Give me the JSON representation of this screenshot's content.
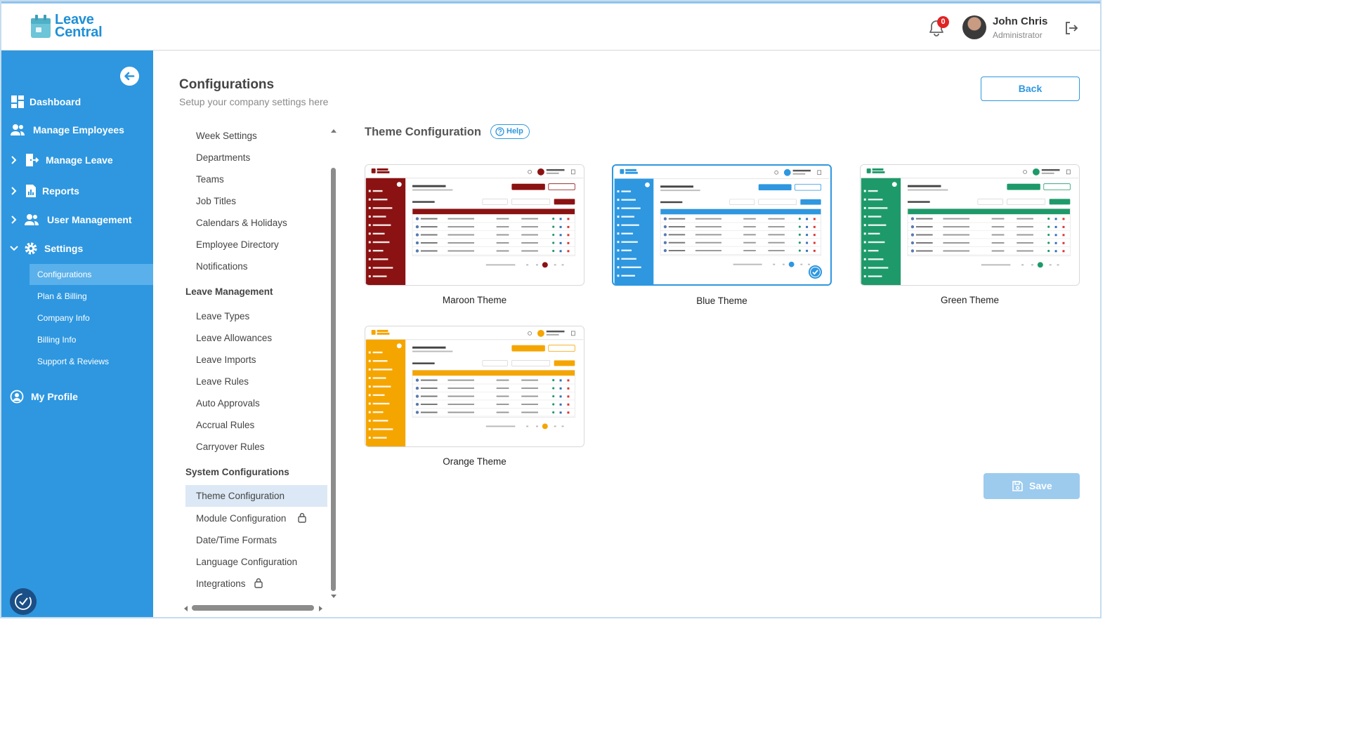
{
  "app": {
    "logo_line1": "Leave",
    "logo_line2": "Central"
  },
  "header": {
    "notification_count": "0",
    "user_name": "John Chris",
    "user_role": "Administrator"
  },
  "sidebar": {
    "items": [
      {
        "label": "Dashboard",
        "icon": "dashboard-icon"
      },
      {
        "label": "Manage Employees",
        "icon": "users-icon"
      },
      {
        "label": "Manage Leave",
        "icon": "door-exit-icon"
      },
      {
        "label": "Reports",
        "icon": "report-icon"
      },
      {
        "label": "User Management",
        "icon": "users-icon"
      },
      {
        "label": "Settings",
        "icon": "gear-icon"
      }
    ],
    "settings_children": [
      "Configurations",
      "Plan & Billing",
      "Company Info",
      "Billing Info",
      "Support & Reviews"
    ],
    "profile": "My Profile"
  },
  "page": {
    "title": "Configurations",
    "subtitle": "Setup your company settings here",
    "back_label": "Back",
    "save_label": "Save"
  },
  "settings_menu": {
    "general": [
      "Week Settings",
      "Departments",
      "Teams",
      "Job Titles",
      "Calendars & Holidays",
      "Employee Directory",
      "Notifications"
    ],
    "leave_header": "Leave Management",
    "leave": [
      "Leave Types",
      "Leave Allowances",
      "Leave Imports",
      "Leave Rules",
      "Auto Approvals",
      "Accrual Rules",
      "Carryover Rules"
    ],
    "system_header": "System Configurations",
    "system": [
      "Theme Configuration",
      "Module Configuration",
      "Date/Time Formats",
      "Language Configuration",
      "Integrations"
    ]
  },
  "theme": {
    "heading": "Theme Configuration",
    "help_label": "Help",
    "themes": [
      {
        "name": "Maroon Theme",
        "color": "#8b1212",
        "selected": false
      },
      {
        "name": "Blue Theme",
        "color": "#2e97e0",
        "selected": true
      },
      {
        "name": "Green Theme",
        "color": "#1e9a6a",
        "selected": false
      },
      {
        "name": "Orange Theme",
        "color": "#f5a500",
        "selected": false
      }
    ]
  }
}
